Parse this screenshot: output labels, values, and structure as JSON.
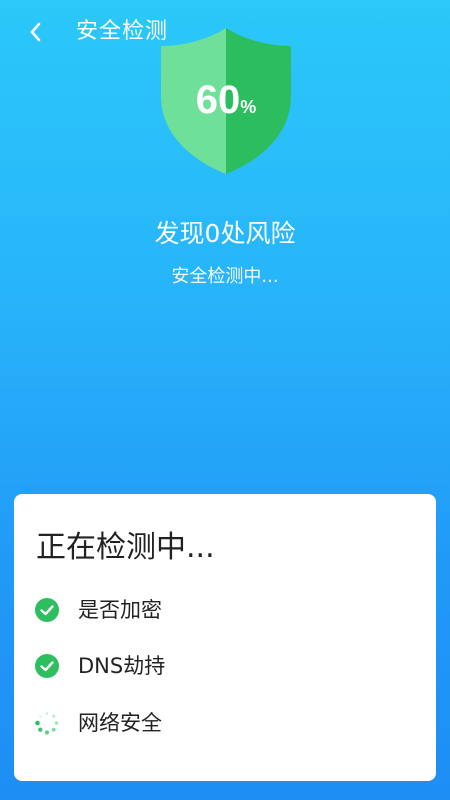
{
  "header": {
    "title": "安全检测",
    "back_icon": "chevron-left-icon"
  },
  "shield": {
    "progress_percent": 60,
    "percent_number": "60",
    "percent_unit": "%",
    "color_left": "#6EE09A",
    "color_right": "#2CBE5E"
  },
  "status": {
    "risk_text": "发现0处风险",
    "sub_text": "安全检测中..."
  },
  "card": {
    "title": "正在检测中...",
    "items": [
      {
        "label": "是否加密",
        "state": "done",
        "icon": "check-circle-icon"
      },
      {
        "label": "DNS劫持",
        "state": "done",
        "icon": "check-circle-icon"
      },
      {
        "label": "网络安全",
        "state": "loading",
        "icon": "loading-spinner-icon"
      }
    ]
  },
  "colors": {
    "background_top": "#2BC8F9",
    "background_bottom": "#1E8EF4",
    "check_green": "#2DBE60"
  }
}
